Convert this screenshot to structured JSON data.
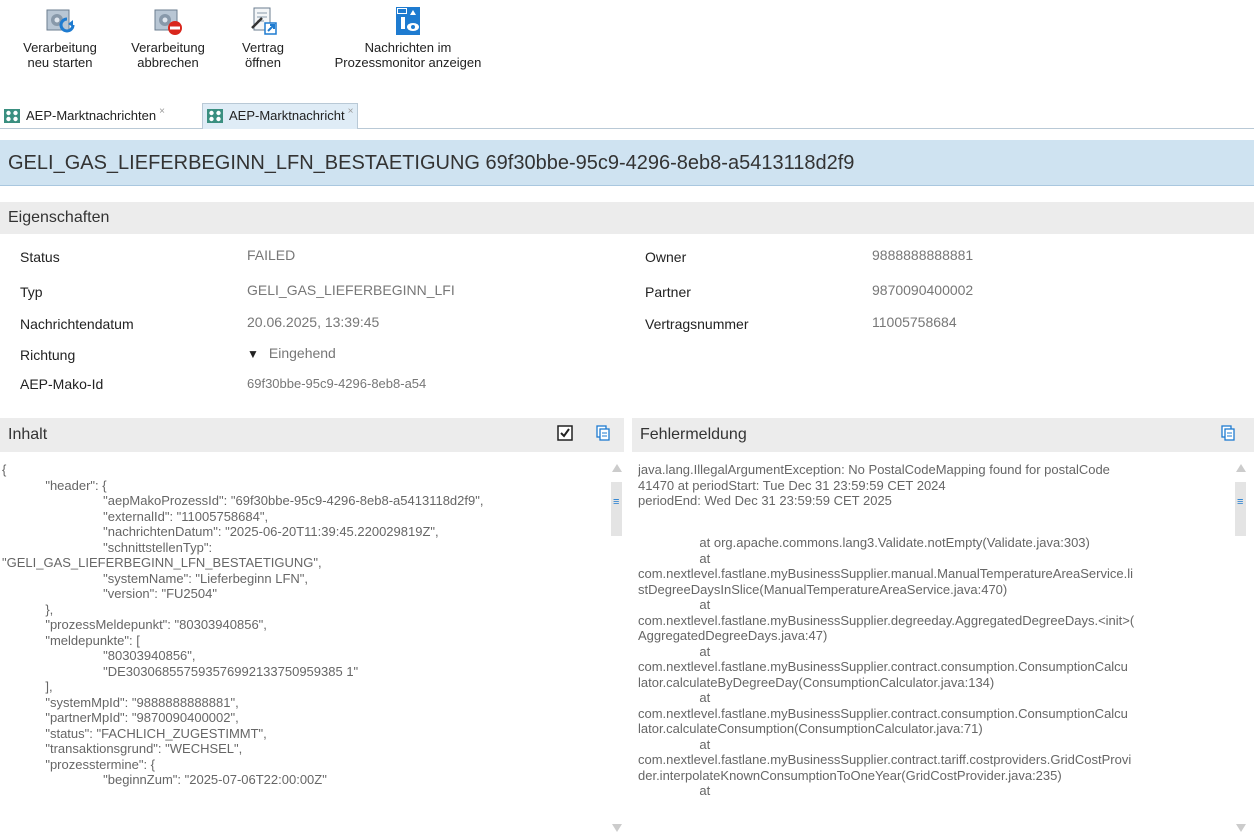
{
  "toolbar": {
    "restart_label": "Verarbeitung\nneu starten",
    "cancel_label": "Verarbeitung\nabbrechen",
    "contract_label": "Vertrag\nöffnen",
    "monitor_label": "Nachrichten im\nProzessmonitor anzeigen"
  },
  "tabs": [
    {
      "label": "AEP-Marktnachrichten",
      "close": "×"
    },
    {
      "label": "AEP-Marktnachricht",
      "close": "×"
    }
  ],
  "page_title": "GELI_GAS_LIEFERBEGINN_LFN_BESTAETIGUNG 69f30bbe-95c9-4296-8eb8-a5413118d2f9",
  "properties": {
    "heading": "Eigenschaften",
    "left": [
      {
        "label": "Status",
        "value": "FAILED"
      },
      {
        "label": "Typ",
        "value": "GELI_GAS_LIEFERBEGINN_LFI"
      },
      {
        "label": "Nachrichtendatum",
        "value": "20.06.2025, 13:39:45"
      },
      {
        "label": "Richtung",
        "value": "Eingehend"
      },
      {
        "label": "AEP-Mako-Id",
        "value": "69f30bbe-95c9-4296-8eb8-a54"
      }
    ],
    "right": [
      {
        "label": "Owner",
        "value": "9888888888881"
      },
      {
        "label": "Partner",
        "value": "9870090400002"
      },
      {
        "label": "Vertragsnummer",
        "value": "11005758684"
      }
    ]
  },
  "content_panel": {
    "heading": "Inhalt",
    "lines": [
      "{",
      "            \"header\": {",
      "                            \"aepMakoProzessId\": \"69f30bbe-95c9-4296-8eb8-a5413118d2f9\",",
      "                            \"externalId\": \"11005758684\",",
      "                            \"nachrichtenDatum\": \"2025-06-20T11:39:45.220029819Z\",",
      "                            \"schnittstellenTyp\":",
      "\"GELI_GAS_LIEFERBEGINN_LFN_BESTAETIGUNG\",",
      "                            \"systemName\": \"Lieferbeginn LFN\",",
      "                            \"version\": \"FU2504\"",
      "            },",
      "            \"prozessMeldepunkt\": \"80303940856\",",
      "            \"meldepunkte\": [",
      "                            \"80303940856\",",
      "                            \"DE303068557593576992133750959385 1\"",
      "            ],",
      "            \"systemMpId\": \"9888888888881\",",
      "            \"partnerMpId\": \"9870090400002\",",
      "            \"status\": \"FACHLICH_ZUGESTIMMT\",",
      "            \"transaktionsgrund\": \"WECHSEL\",",
      "            \"prozesstermine\": {",
      "                            \"beginnZum\": \"2025-07-06T22:00:00Z\""
    ]
  },
  "error_panel": {
    "heading": "Fehlermeldung",
    "lines": [
      "java.lang.IllegalArgumentException: No PostalCodeMapping found for postalCode",
      "41470 at periodStart: Tue Dec 31 23:59:59 CET 2024",
      "periodEnd: Wed Dec 31 23:59:59 CET 2025",
      "",
      "",
      "                 at org.apache.commons.lang3.Validate.notEmpty(Validate.java:303)",
      "                 at",
      "com.nextlevel.fastlane.myBusinessSupplier.manual.ManualTemperatureAreaService.li",
      "stDegreeDaysInSlice(ManualTemperatureAreaService.java:470)",
      "                 at",
      "com.nextlevel.fastlane.myBusinessSupplier.degreeday.AggregatedDegreeDays.<init>(",
      "AggregatedDegreeDays.java:47)",
      "                 at",
      "com.nextlevel.fastlane.myBusinessSupplier.contract.consumption.ConsumptionCalcu",
      "lator.calculateByDegreeDay(ConsumptionCalculator.java:134)",
      "                 at",
      "com.nextlevel.fastlane.myBusinessSupplier.contract.consumption.ConsumptionCalcu",
      "lator.calculateConsumption(ConsumptionCalculator.java:71)",
      "                 at",
      "com.nextlevel.fastlane.myBusinessSupplier.contract.tariff.costproviders.GridCostProvi",
      "der.interpolateKnownConsumptionToOneYear(GridCostProvider.java:235)",
      "                 at"
    ]
  },
  "colors": {
    "title_bg": "#cfe3f1",
    "section_bg": "#ececec",
    "icon_blue": "#1e7bd0",
    "icon_red": "#d9261c"
  }
}
